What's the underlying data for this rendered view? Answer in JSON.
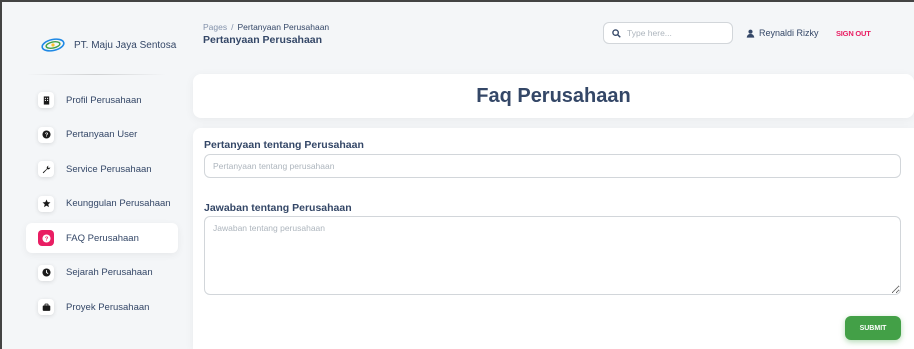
{
  "brand": {
    "name": "PT. Maju Jaya Sentosa"
  },
  "sidebar": {
    "items": [
      {
        "label": "Profil Perusahaan",
        "icon": "building-icon",
        "active": false
      },
      {
        "label": "Pertanyaan User",
        "icon": "question-icon",
        "active": false
      },
      {
        "label": "Service Perusahaan",
        "icon": "wrench-icon",
        "active": false
      },
      {
        "label": "Keunggulan Perusahaan",
        "icon": "star-icon",
        "active": false
      },
      {
        "label": "FAQ Perusahaan",
        "icon": "question-icon",
        "active": true
      },
      {
        "label": "Sejarah Perusahaan",
        "icon": "clock-icon",
        "active": false
      },
      {
        "label": "Proyek Perusahaan",
        "icon": "briefcase-icon",
        "active": false
      }
    ]
  },
  "header": {
    "breadcrumb_root": "Pages",
    "breadcrumb_sep": "/",
    "breadcrumb_current": "Pertanyaan Perusahaan",
    "page_title": "Pertanyaan Perusahaan",
    "search_placeholder": "Type here...",
    "user_name": "Reynaldi Rizky",
    "signout_label": "SIGN OUT"
  },
  "main": {
    "card_title": "Faq Perusahaan",
    "question_label": "Pertanyaan tentang Perusahaan",
    "question_placeholder": "Pertanyaan tentang perusahaan",
    "answer_label": "Jawaban tentang Perusahaan",
    "answer_placeholder": "Jawaban tentang perusahaan",
    "submit_label": "SUBMIT"
  },
  "colors": {
    "accent": "#e91e63",
    "submit": "#43a047",
    "text": "#344767"
  }
}
